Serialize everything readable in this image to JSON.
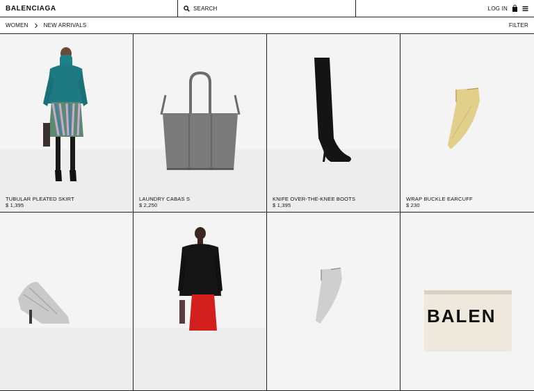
{
  "header": {
    "logo": "BALENCIAGA",
    "search_label": "SEARCH",
    "login_label": "LOG IN"
  },
  "subnav": {
    "breadcrumb": [
      "WOMEN",
      "NEW ARRIVALS"
    ],
    "filter_label": "FILTER"
  },
  "products": [
    {
      "name": "TUBULAR PLEATED SKIRT",
      "price": "$ 1,395"
    },
    {
      "name": "LAUNDRY CABAS S",
      "price": "$ 2,250"
    },
    {
      "name": "KNIFE OVER-THE-KNEE BOOTS",
      "price": "$ 1,395"
    },
    {
      "name": "WRAP BUCKLE EARCUFF",
      "price": "$ 230"
    },
    {
      "name": "",
      "price": ""
    },
    {
      "name": "",
      "price": ""
    },
    {
      "name": "",
      "price": ""
    },
    {
      "name": "",
      "price": ""
    }
  ],
  "pouch_print": "BALEN"
}
